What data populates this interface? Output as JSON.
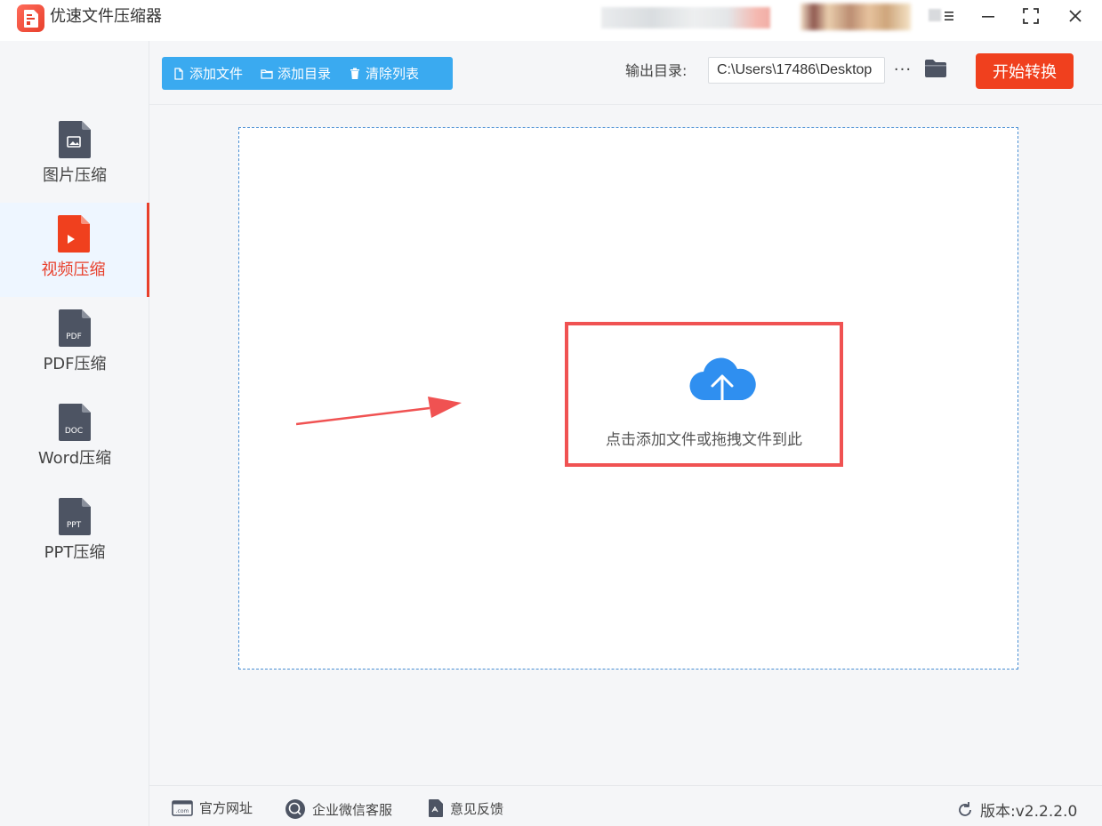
{
  "app": {
    "title": "优速文件压缩器"
  },
  "sidebar": {
    "items": [
      {
        "label": "图片压缩",
        "icon": "image-file-icon",
        "badge": ""
      },
      {
        "label": "视频压缩",
        "icon": "video-file-icon",
        "badge": ""
      },
      {
        "label": "PDF压缩",
        "icon": "pdf-file-icon",
        "badge": "PDF"
      },
      {
        "label": "Word压缩",
        "icon": "doc-file-icon",
        "badge": "DOC"
      },
      {
        "label": "PPT压缩",
        "icon": "ppt-file-icon",
        "badge": "PPT"
      }
    ],
    "active_index": 1
  },
  "toolbar": {
    "add_file": "添加文件",
    "add_folder": "添加目录",
    "clear_list": "清除列表",
    "output_label": "输出目录:",
    "output_path": "C:\\Users\\17486\\Desktop",
    "more": "···",
    "start": "开始转换"
  },
  "dropzone": {
    "hint": "点击添加文件或拖拽文件到此"
  },
  "footer": {
    "website": "官方网址",
    "wechat": "企业微信客服",
    "feedback": "意见反馈",
    "version": "版本:v2.2.2.0"
  },
  "colors": {
    "accent_red": "#f0401e",
    "tool_blue": "#3aaaf0",
    "icon_gray": "#4d5463",
    "video_red": "#f0401e",
    "cloud_blue": "#2f8ff0",
    "highlight_red": "#f05252"
  }
}
